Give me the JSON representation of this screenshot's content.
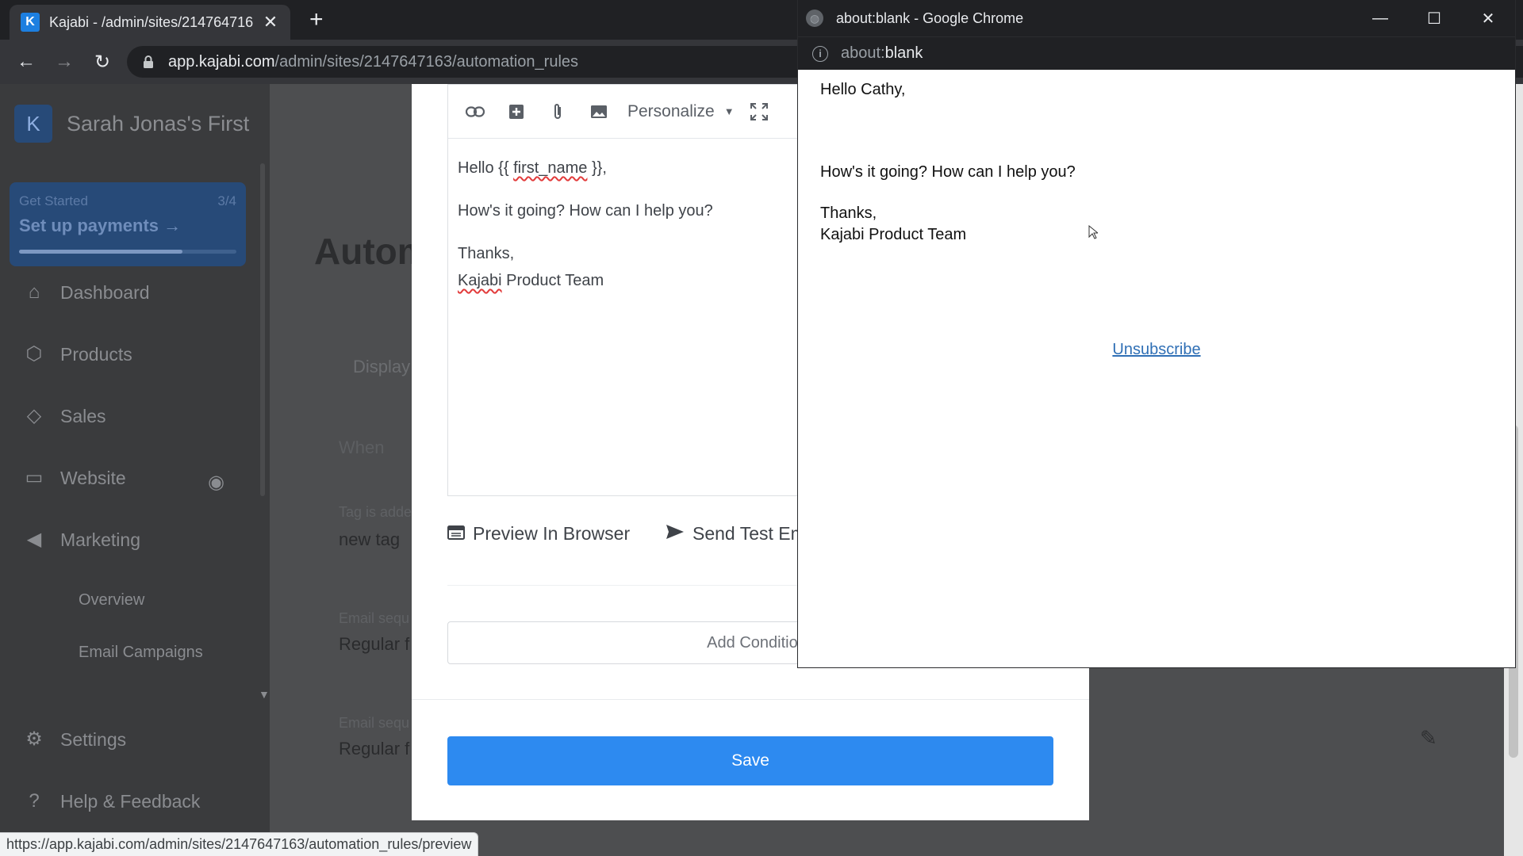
{
  "browser": {
    "tab_title": "Kajabi - /admin/sites/214764716",
    "tab_close": "✕",
    "new_tab": "+",
    "url_host": "app.kajabi.com",
    "url_path": "/admin/sites/2147647163/automation_rules",
    "status_url": "https://app.kajabi.com/admin/sites/2147647163/automation_rules/preview"
  },
  "sidebar": {
    "site_name": "Sarah Jonas's First",
    "get_started": {
      "label": "Get Started",
      "progress_text": "3/4",
      "title": "Set up payments",
      "progress": 0.75
    },
    "items": [
      {
        "label": "Dashboard",
        "icon": "home-icon"
      },
      {
        "label": "Products",
        "icon": "box-icon"
      },
      {
        "label": "Sales",
        "icon": "tag-icon"
      },
      {
        "label": "Website",
        "icon": "monitor-icon"
      },
      {
        "label": "Marketing",
        "icon": "megaphone-icon"
      }
    ],
    "marketing_sub": [
      "Overview",
      "Email Campaigns"
    ],
    "settings": "Settings",
    "help": "Help & Feedback"
  },
  "background": {
    "title": "Autom",
    "display": "Display",
    "when": "When",
    "tag_hint": "Tag is adde",
    "tag_value": "new tag",
    "email_hint_1": "Email sequ",
    "email_value_1": "Regular f",
    "email_hint_2": "Email sequ",
    "email_value_2": "Regular f"
  },
  "modal": {
    "personalize": "Personalize",
    "body": {
      "greeting_pre": "Hello {{ ",
      "greeting_var": "first_name",
      "greeting_post": " }},",
      "line2": "How's it going? How can I help you?",
      "line3": "Thanks,",
      "sig_brand": "Kajabi",
      "sig_rest": " Product Team"
    },
    "preview_label": "Preview In Browser",
    "send_test_label": "Send Test Em",
    "add_condition_label": "Add Condition",
    "save_label": "Save"
  },
  "popup": {
    "window_title": "about:blank - Google Chrome",
    "url_dim": "about:",
    "url_main": "blank",
    "body": {
      "greeting": "Hello Cathy,",
      "line2": "How's it going? How can I help you?",
      "line3": "Thanks,",
      "line4": "Kajabi Product Team",
      "unsubscribe": "Unsubscribe"
    }
  },
  "colors": {
    "save_button": "#2d8af0",
    "get_started_bg": "#274a78",
    "link": "#2f6fb5"
  }
}
